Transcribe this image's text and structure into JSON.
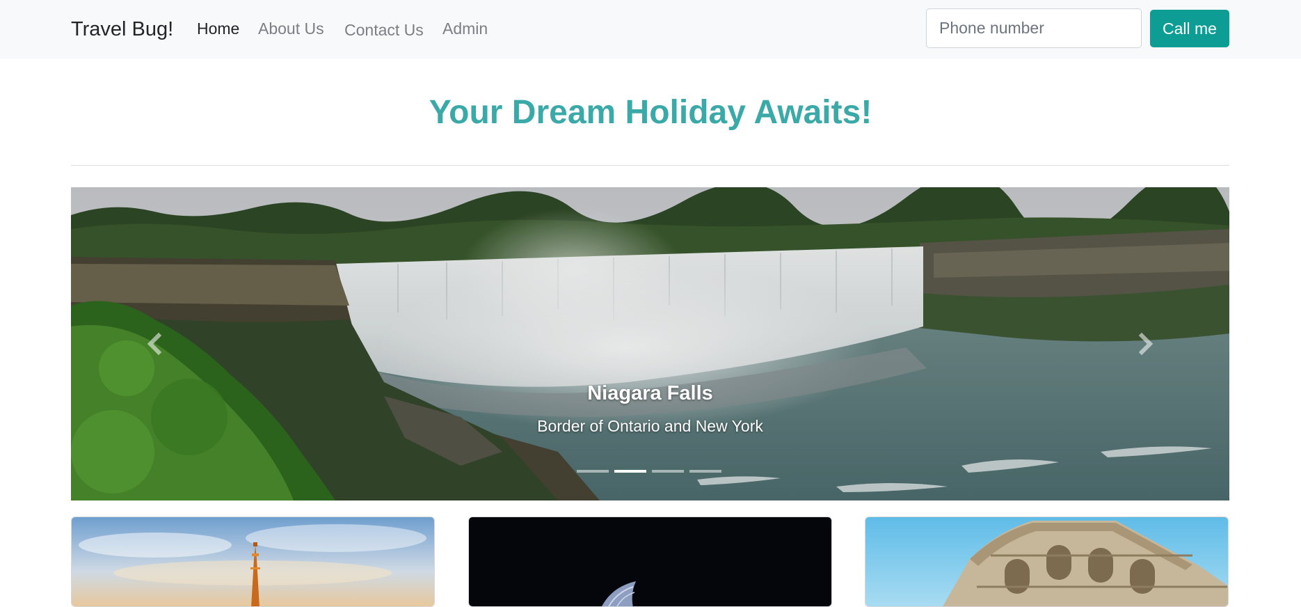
{
  "navbar": {
    "brand": "Travel Bug!",
    "links": [
      {
        "label": "Home",
        "active": true
      },
      {
        "label": "About Us",
        "active": false
      },
      {
        "label": "Contact Us",
        "active": false
      },
      {
        "label": "Admin",
        "active": false
      }
    ],
    "phone_placeholder": "Phone number",
    "call_label": "Call me"
  },
  "headline": "Your Dream Holiday Awaits!",
  "carousel": {
    "caption_title": "Niagara Falls",
    "caption_subtitle": "Border of Ontario and New York",
    "slide_count": 4,
    "active_index": 1,
    "prev_icon": "chevron-left-icon",
    "next_icon": "chevron-right-icon"
  },
  "cards": [
    {
      "image": "eiffel-tower-image"
    },
    {
      "image": "sydney-opera-house-image"
    },
    {
      "image": "colosseum-image"
    }
  ],
  "colors": {
    "accent": "#3aa9a8",
    "button": "#0e9d94",
    "navbar_bg": "#f8f9fa"
  }
}
